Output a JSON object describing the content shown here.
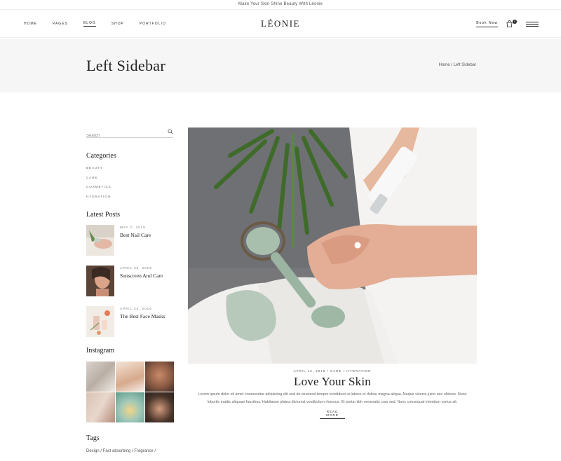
{
  "topbar": {
    "announcement": "Make Your Skin Shine Beauty With Léonie"
  },
  "header": {
    "nav": [
      "Home",
      "Pages",
      "Blog",
      "Shop",
      "Portfolio"
    ],
    "active_nav": "Blog",
    "logo": "LÉONIE",
    "book_now": "Book Now",
    "cart_count": "0"
  },
  "titlebar": {
    "title": "Left Sidebar",
    "breadcrumb": "Home / Left Sidebar"
  },
  "sidebar": {
    "search_placeholder": "Search",
    "categories_title": "Categories",
    "categories": [
      "Beauty",
      "Care",
      "Cosmetics",
      "Hydration"
    ],
    "latest_title": "Latest Posts",
    "latest_posts": [
      {
        "date": "May 7, 2019",
        "title": "Best Nail Care"
      },
      {
        "date": "April 25, 2019",
        "title": "Sunscreen And Care"
      },
      {
        "date": "April 25, 2019",
        "title": "The Best Face Masks"
      }
    ],
    "instagram_title": "Instagram",
    "tags_title": "Tags",
    "tags_line": "Design / Fast absorbing / Fragrance /"
  },
  "post": {
    "meta": "April 12, 2019 / Care / Hydration",
    "title": "Love Your Skin",
    "excerpt": "Lorem ipsum dolor sit amet consectetur adipiscing elit sed do eiusmod tempor incididunt ut labore et dolore magna aliqua. Neque viverra justo nec ultrices. Nunc lobortis mattis aliquam faucibus. Habitasse platea dictumst vestibulum rhoncus. Et porta nibh venenatis cras sed. Nunc consequat interdum varius sit.",
    "read_more": "Read More"
  },
  "colors": {
    "text": "#222222",
    "muted": "#666666",
    "titlebar_bg": "#f6f6f6"
  }
}
